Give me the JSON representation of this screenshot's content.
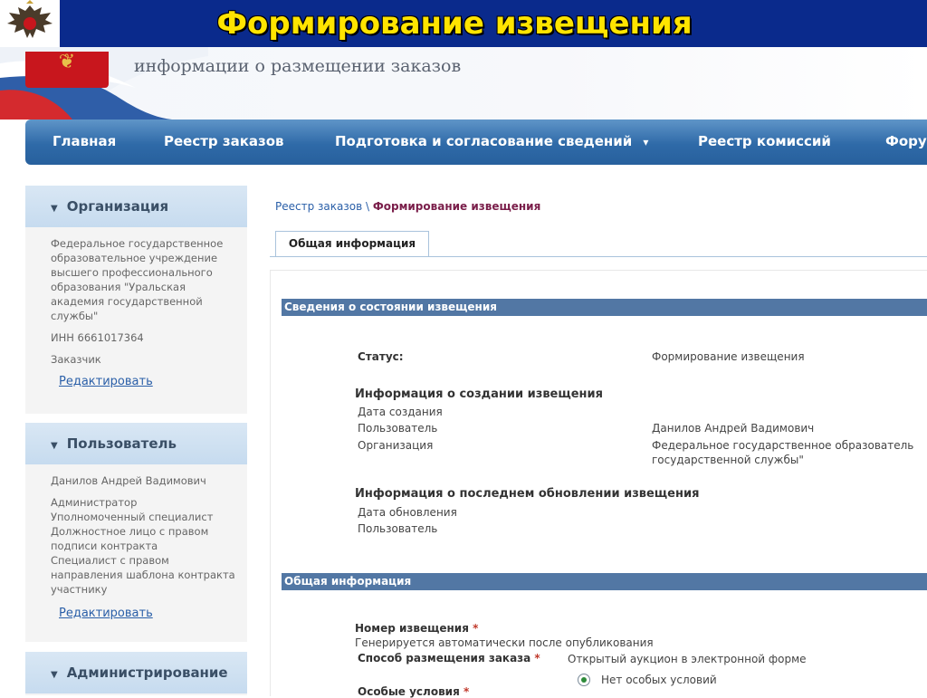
{
  "banner": {
    "title": "Формирование извещения",
    "emblem_icon": "double-headed-eagle-emblem"
  },
  "header": {
    "subtitle": "информации о размещении заказов",
    "crest_icon": "coat-of-arms-icon"
  },
  "nav": {
    "items": [
      {
        "label": "Главная"
      },
      {
        "label": "Реестр заказов"
      },
      {
        "label": "Подготовка и согласование сведений"
      },
      {
        "label": "Реестр комиссий"
      },
      {
        "label": "Фору"
      }
    ],
    "dropdown_icon": "chevron-down-icon"
  },
  "sidebar": {
    "organization": {
      "title": "Организация",
      "name": "Федеральное государственное образовательное учреждение высшего профессионального образования \"Уральская академия государственной службы\"",
      "inn": "ИНН 6661017364",
      "role": "Заказчик",
      "edit_label": "Редактировать"
    },
    "user": {
      "title": "Пользователь",
      "name": "Данилов Андрей Вадимович",
      "roles": [
        "Администратор",
        "Уполномоченный специалист",
        "Должностное лицо с правом подписи контракта",
        "Специалист с правом направления шаблона контракта участнику"
      ],
      "edit_label": "Редактировать"
    },
    "admin": {
      "title": "Администрирование"
    }
  },
  "breadcrumb": {
    "link": "Реестр заказов",
    "separator": "\\",
    "current": "Формирование извещения"
  },
  "tabs": [
    {
      "label": "Общая информация"
    }
  ],
  "status_section": {
    "title": "Сведения о состоянии извещения",
    "status_label": "Статус:",
    "status_value": "Формирование извещения",
    "creation": {
      "heading": "Информация о создании извещения",
      "date_label": "Дата создания",
      "user_label": "Пользователь",
      "user_value": "Данилов Андрей Вадимович",
      "org_label": "Организация",
      "org_value_line1": "Федеральное государственное образователь",
      "org_value_line2": "государственной службы\""
    },
    "update": {
      "heading": "Информация о последнем обновлении извещения",
      "date_label": "Дата обновления",
      "user_label": "Пользователь"
    }
  },
  "general_section": {
    "title": "Общая информация",
    "notice_number_label": "Номер извещения",
    "required_mark": "*",
    "notice_number_hint": "Генерируется автоматически после опубликования",
    "method_label": "Способ размещения заказа",
    "method_value": "Открытый аукцион в электронной форме",
    "radio_label": "Нет особых условий",
    "special_conditions_label": "Особые условия"
  },
  "colors": {
    "banner_bg": "#0a2a8c",
    "banner_title": "#ffe400",
    "nav_bg": "#2f6aa8",
    "section_bar": "#5277a4",
    "link": "#2a5fa8",
    "breadcrumb_current": "#7a1e4a",
    "required": "#c0392b"
  }
}
